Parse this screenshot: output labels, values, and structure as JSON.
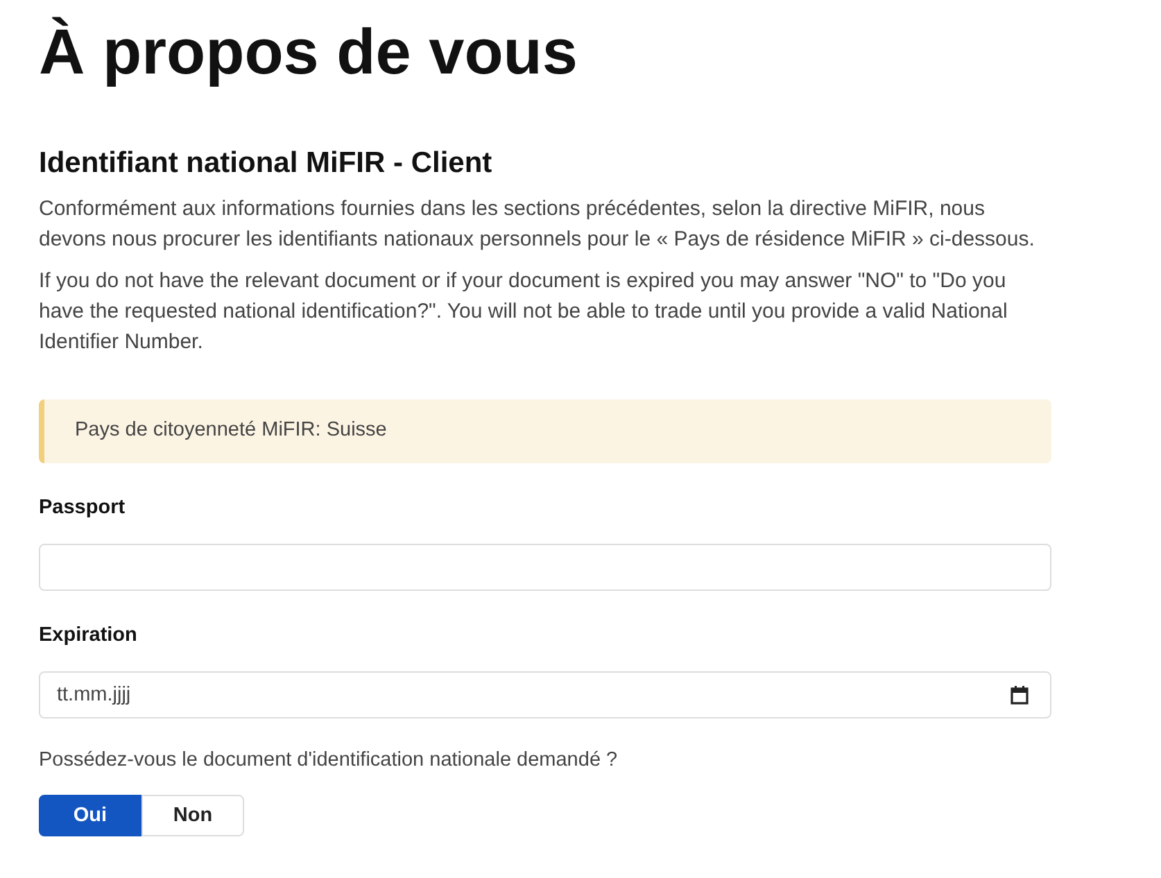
{
  "page_title": "À propos de vous",
  "section": {
    "title": "Identifiant national MiFIR - Client",
    "paragraphs": [
      "Conformément aux informations fournies dans les sections précédentes, selon la directive MiFIR, nous devons nous procurer les identifiants nationaux personnels pour le « Pays de résidence MiFIR » ci-dessous.",
      "If you do not have the relevant document or if your document is expired you may answer \"NO\" to \"Do you have the requested national identification?\". You will not be able to trade until you provide a valid National Identifier Number."
    ]
  },
  "notice": "Pays de citoyenneté MiFIR: Suisse",
  "fields": [
    {
      "kind": "text",
      "label": "Passport"
    },
    {
      "kind": "date",
      "label": "Expiration",
      "placeholder": "tt.mm.jjjj"
    }
  ],
  "question": "Possédez-vous le document d'identification nationale demandé ?",
  "answers": [
    {
      "label": "Oui",
      "selected": true
    },
    {
      "label": "Non",
      "selected": false
    }
  ]
}
